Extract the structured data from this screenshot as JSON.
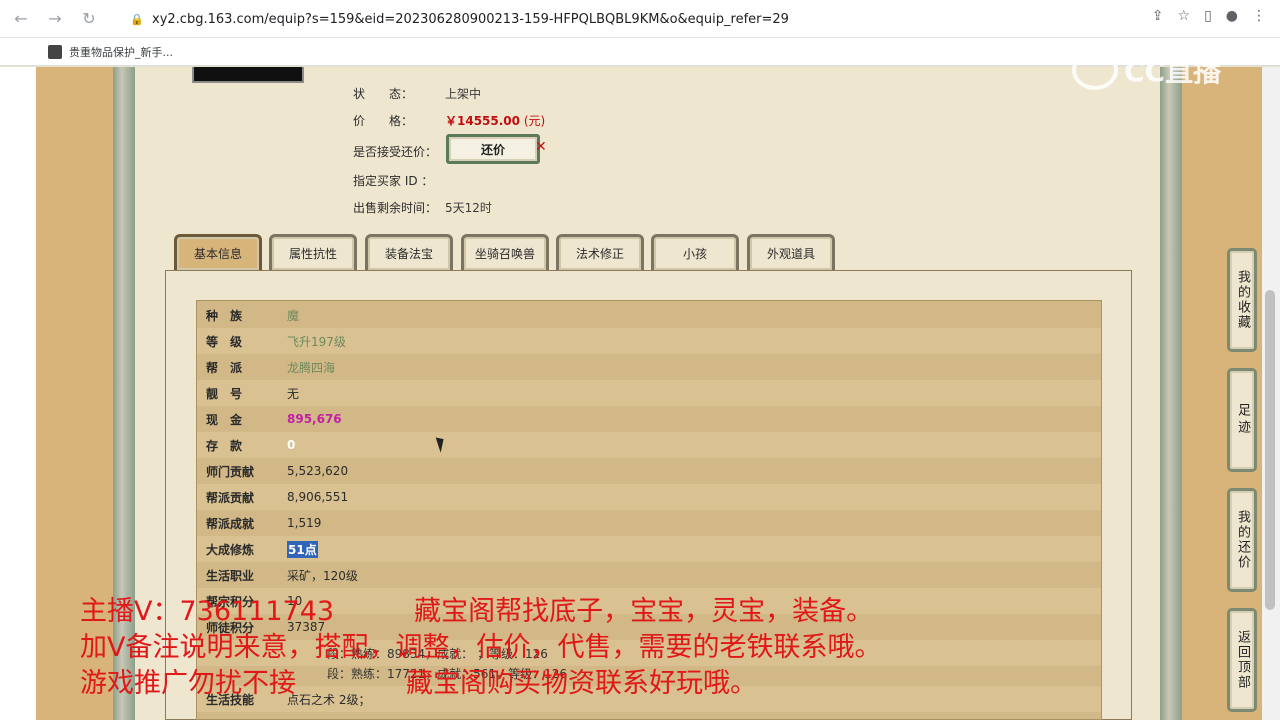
{
  "browser": {
    "url": "xy2.cbg.163.com/equip?s=159&eid=202306280900213-159-HFPQLBQBL9KM&o&equip_refer=29",
    "bookmark": "贵重物品保护_新手..."
  },
  "watermark": "CC直播",
  "header": {
    "status_label": "状　　态：",
    "status_value": "上架中",
    "price_label": "价　　格：",
    "price_value": "￥14555.00",
    "price_unit": "(元)",
    "counter_label": "是否接受还价：",
    "counter_button": "还价",
    "buyer_label": "指定买家 ID ：",
    "remaining_label": "出售剩余时间：",
    "remaining_value": "5天12时"
  },
  "tabs": [
    "基本信息",
    "属性抗性",
    "装备法宝",
    "坐骑召唤兽",
    "法术修正",
    "小孩",
    "外观道具"
  ],
  "rows": [
    {
      "label": "种　族",
      "value": "魔"
    },
    {
      "label": "等　级",
      "value": "飞升197级"
    },
    {
      "label": "帮　派",
      "value": "龙腾四海"
    },
    {
      "label": "靓　号",
      "value": "无"
    },
    {
      "label": "现　金",
      "value": "895,676"
    },
    {
      "label": "存　款",
      "value": "0"
    },
    {
      "label": "师门贡献",
      "value": "5,523,620"
    },
    {
      "label": "帮派贡献",
      "value": "8,906,551"
    },
    {
      "label": "帮派成就",
      "value": "1,519"
    },
    {
      "label": "大成修炼",
      "value": "51点"
    },
    {
      "label": "生活职业",
      "value": "采矿，120级"
    },
    {
      "label": "帮宗积分",
      "value": "10"
    },
    {
      "label": "师徒积分",
      "value": "37387"
    },
    {
      "label": "",
      "value": "段：熟练：89834，成就：    ；等级：126"
    },
    {
      "label": "",
      "value": "段：熟练：17721，成就：561，等级：126"
    },
    {
      "label": "生活技能",
      "value": "点石之术 2级；"
    }
  ],
  "side_buttons": [
    "我的收藏",
    "足迹",
    "我的还价",
    "返回顶部"
  ],
  "overlay": {
    "line1_left": "主播V：736111743",
    "line1_right": "藏宝阁帮找底子，宝宝，灵宝，装备。",
    "line2": "加V备注说明来意，搭配，调整，估价，代售，需要的老铁联系哦。",
    "line3_left": "游戏推广勿扰不接",
    "line3_right": "藏宝阁购买物资联系好玩哦。"
  }
}
